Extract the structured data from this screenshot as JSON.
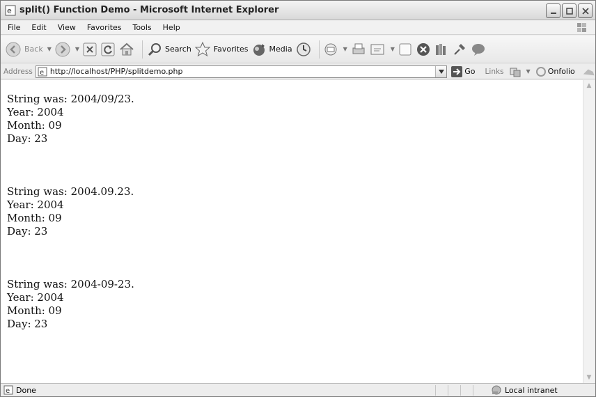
{
  "window": {
    "title": "split() Function Demo - Microsoft Internet Explorer"
  },
  "menu": [
    "File",
    "Edit",
    "View",
    "Favorites",
    "Tools",
    "Help"
  ],
  "toolbar": {
    "back": "Back",
    "search": "Search",
    "favorites": "Favorites",
    "media": "Media"
  },
  "address": {
    "label": "Address",
    "url": "http://localhost/PHP/splitdemo.php",
    "go": "Go",
    "links": "Links",
    "onfolio": "Onfolio"
  },
  "content": {
    "blocks": [
      {
        "line1": "String was: 2004/09/23.",
        "line2": "Year: 2004",
        "line3": "Month: 09",
        "line4": "Day: 23"
      },
      {
        "line1": "String was: 2004.09.23.",
        "line2": "Year: 2004",
        "line3": "Month: 09",
        "line4": "Day: 23"
      },
      {
        "line1": "String was: 2004-09-23.",
        "line2": "Year: 2004",
        "line3": "Month: 09",
        "line4": "Day: 23"
      }
    ]
  },
  "status": {
    "text": "Done",
    "zone": "Local intranet"
  },
  "icons": {
    "titlebar": "ie-page-icon",
    "back": "back-arrow-icon",
    "forward": "forward-arrow-icon",
    "stop": "stop-icon",
    "refresh": "refresh-icon",
    "home": "home-icon",
    "search": "magnifier-icon",
    "favorites": "star-icon",
    "media": "media-icon",
    "history": "history-icon",
    "mail": "mail-icon",
    "print": "print-icon",
    "edit": "edit-icon",
    "discuss": "discuss-icon",
    "messenger": "messenger-icon"
  },
  "colors": {
    "chrome": "#ececec",
    "content_bg": "#ffffff",
    "text": "#111111"
  }
}
